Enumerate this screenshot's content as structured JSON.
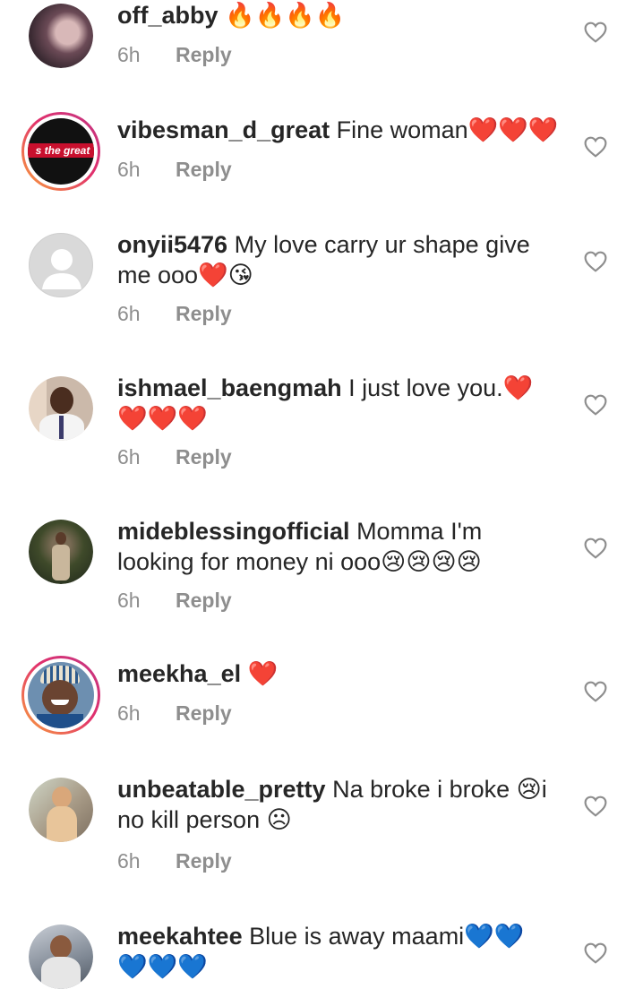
{
  "comments": [
    {
      "username": "off_abby",
      "text": " 🔥🔥🔥🔥",
      "time": "6h",
      "reply": "Reply"
    },
    {
      "username": "vibesman_d_great",
      "text": " Fine woman❤️❤️❤️",
      "time": "6h",
      "reply": "Reply",
      "avatar_text": "s the great"
    },
    {
      "username": "onyii5476",
      "text": " My love carry ur shape give me ooo❤️😘",
      "time": "6h",
      "reply": "Reply"
    },
    {
      "username": "ishmael_baengmah",
      "text": " I just love you.❤️ ❤️❤️❤️",
      "time": "6h",
      "reply": "Reply"
    },
    {
      "username": "mideblessingofficial",
      "text": " Momma I'm looking for money ni ooo😢😢😢😢",
      "time": "6h",
      "reply": "Reply"
    },
    {
      "username": "meekha_el",
      "text": " ❤️",
      "time": "6h",
      "reply": "Reply"
    },
    {
      "username": "unbeatable_pretty",
      "text": " Na broke i broke 😢i no kill person ☹",
      "time": "6h",
      "reply": "Reply"
    },
    {
      "username": "meekahtee",
      "text": " Blue is away maami💙💙 💙💙💙",
      "time": "",
      "reply": ""
    }
  ],
  "colors": {
    "heart_red": "#e0245e",
    "blue_heart": "#1d8bf0",
    "meta_gray": "#8e8e8e"
  },
  "icons": {
    "like": "heart-outline-icon"
  }
}
